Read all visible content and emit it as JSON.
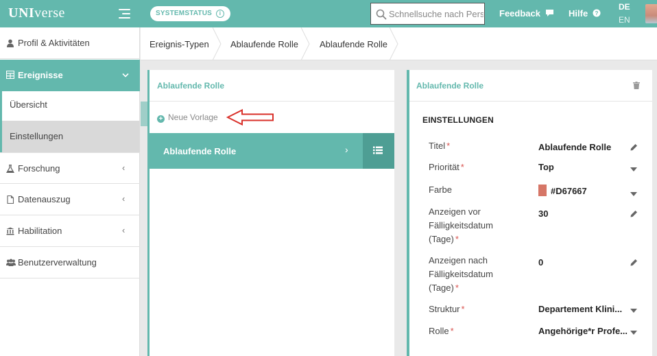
{
  "header": {
    "brand_bold": "UNI",
    "brand_rest": "verse",
    "status_label": "SYSTEMSTATUS",
    "search_placeholder": "Schnellsuche nach Personen",
    "feedback_label": "Feedback",
    "help_label": "Hilfe",
    "lang_active": "DE",
    "lang_other": "EN"
  },
  "sidebar": {
    "items": [
      {
        "label": "Profil & Aktivitäten",
        "icon": "user-icon"
      },
      {
        "label": "Ereignisse",
        "icon": "table-icon"
      },
      {
        "label": "Übersicht"
      },
      {
        "label": "Einstellungen"
      },
      {
        "label": "Forschung",
        "icon": "flask-icon"
      },
      {
        "label": "Datenauszug",
        "icon": "file-icon"
      },
      {
        "label": "Habilitation",
        "icon": "institution-icon"
      },
      {
        "label": "Benutzerverwaltung",
        "icon": "users-icon"
      }
    ]
  },
  "breadcrumb": [
    "Ereignis-Typen",
    "Ablaufende Rolle",
    "Ablaufende Rolle"
  ],
  "left_panel": {
    "title": "Ablaufende Rolle",
    "new_template": "Neue Vorlage",
    "rows": [
      {
        "label": "Ablaufende Rolle"
      }
    ]
  },
  "right_panel": {
    "title": "Ablaufende Rolle",
    "section": "EINSTELLUNGEN",
    "fields": {
      "title": {
        "label": "Titel",
        "value": "Ablaufende Rolle"
      },
      "priority": {
        "label": "Priorität",
        "value": "Top"
      },
      "color": {
        "label": "Farbe",
        "value": "#D67667"
      },
      "show_before": {
        "label": "Anzeigen vor Fälligkeitsdatum (Tage)",
        "value": "30"
      },
      "show_after": {
        "label": "Anzeigen nach Fälligkeitsdatum (Tage)",
        "value": "0"
      },
      "structure": {
        "label": "Struktur",
        "value": "Departement Klini..."
      },
      "role": {
        "label": "Rolle",
        "value": "Angehörige*r Profe..."
      }
    }
  },
  "colors": {
    "accent": "#63b8ad",
    "accent_dark": "#4e9e94",
    "required": "#d9534f",
    "arrow": "#d9302a"
  }
}
